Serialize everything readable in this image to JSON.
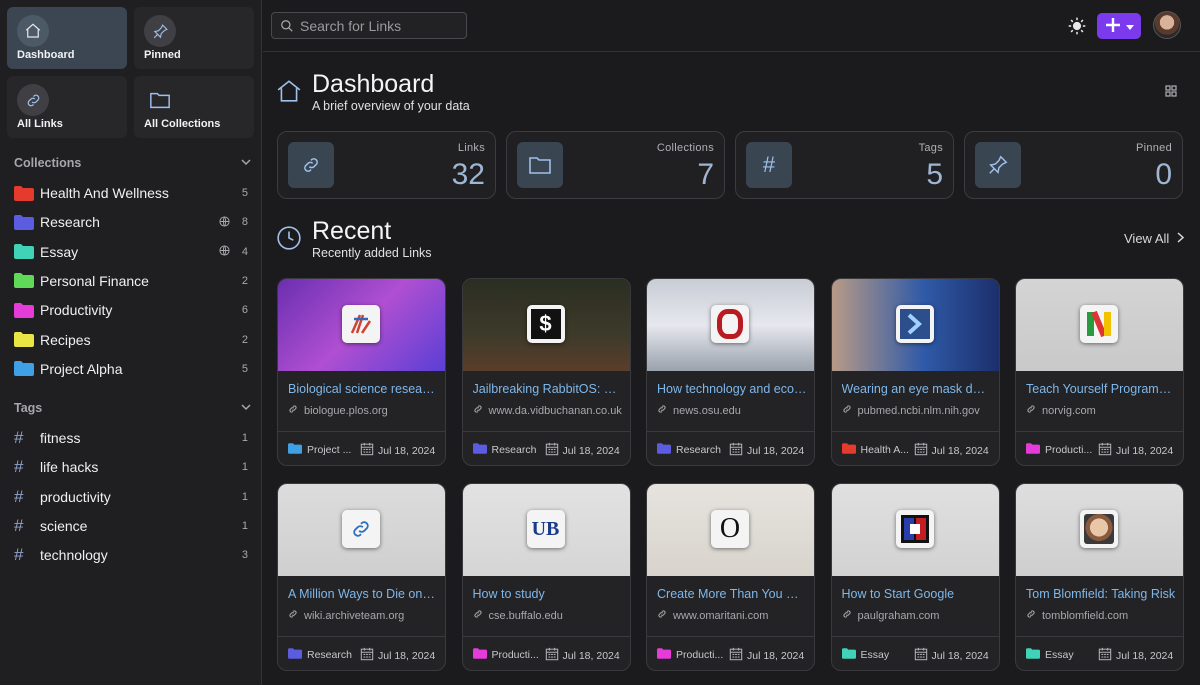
{
  "sidebar": {
    "quick": [
      {
        "label": "Dashboard"
      },
      {
        "label": "Pinned"
      },
      {
        "label": "All Links"
      },
      {
        "label": "All Collections"
      }
    ],
    "collections_heading": "Collections",
    "collections": [
      {
        "name": "Health And Wellness",
        "count": "5",
        "color": "#e53b2f",
        "public": false
      },
      {
        "name": "Research",
        "count": "8",
        "color": "#5b5ce0",
        "public": true
      },
      {
        "name": "Essay",
        "count": "4",
        "color": "#41d3b7",
        "public": true
      },
      {
        "name": "Personal Finance",
        "count": "2",
        "color": "#5fd957",
        "public": false
      },
      {
        "name": "Productivity",
        "count": "6",
        "color": "#e53bd8",
        "public": false
      },
      {
        "name": "Recipes",
        "count": "2",
        "color": "#e8e545",
        "public": false
      },
      {
        "name": "Project Alpha",
        "count": "5",
        "color": "#3fa0e6",
        "public": false
      }
    ],
    "tags_heading": "Tags",
    "tags": [
      {
        "name": "fitness",
        "count": "1"
      },
      {
        "name": "life hacks",
        "count": "1"
      },
      {
        "name": "productivity",
        "count": "1"
      },
      {
        "name": "science",
        "count": "1"
      },
      {
        "name": "technology",
        "count": "3"
      }
    ]
  },
  "topbar": {
    "search_placeholder": "Search for Links",
    "accent": "#7c3aed"
  },
  "dashboard": {
    "title": "Dashboard",
    "subtitle": "A brief overview of your data",
    "stats": [
      {
        "label": "Links",
        "value": "32",
        "icon": "link-icon"
      },
      {
        "label": "Collections",
        "value": "7",
        "icon": "folder-icon"
      },
      {
        "label": "Tags",
        "value": "5",
        "icon": "hash-icon"
      },
      {
        "label": "Pinned",
        "value": "0",
        "icon": "pin-icon"
      }
    ]
  },
  "recent": {
    "title": "Recent",
    "subtitle": "Recently added Links",
    "view_all": "View All",
    "links": [
      {
        "title": "Biological science research...",
        "domain": "biologue.plos.org",
        "collection": "Project ...",
        "coll_color": "#3fa0e6",
        "date": "Jul 18, 2024"
      },
      {
        "title": "Jailbreaking RabbitOS: Un...",
        "domain": "www.da.vidbuchanan.co.uk",
        "collection": "Research",
        "coll_color": "#5b5ce0",
        "date": "Jul 18, 2024"
      },
      {
        "title": "How technology and econ...",
        "domain": "news.osu.edu",
        "collection": "Research",
        "coll_color": "#5b5ce0",
        "date": "Jul 18, 2024"
      },
      {
        "title": "Wearing an eye mask duri...",
        "domain": "pubmed.ncbi.nlm.nih.gov",
        "collection": "Health A...",
        "coll_color": "#e53b2f",
        "date": "Jul 18, 2024"
      },
      {
        "title": "Teach Yourself Programmi...",
        "domain": "norvig.com",
        "collection": "Producti...",
        "coll_color": "#e53bd8",
        "date": "Jul 18, 2024"
      },
      {
        "title": "A Million Ways to Die on t...",
        "domain": "wiki.archiveteam.org",
        "collection": "Research",
        "coll_color": "#5b5ce0",
        "date": "Jul 18, 2024"
      },
      {
        "title": "How to study",
        "domain": "cse.buffalo.edu",
        "collection": "Producti...",
        "coll_color": "#e53bd8",
        "date": "Jul 18, 2024"
      },
      {
        "title": "Create More Than You Co...",
        "domain": "www.omaritani.com",
        "collection": "Producti...",
        "coll_color": "#e53bd8",
        "date": "Jul 18, 2024"
      },
      {
        "title": "How to Start Google",
        "domain": "paulgraham.com",
        "collection": "Essay",
        "coll_color": "#41d3b7",
        "date": "Jul 18, 2024"
      },
      {
        "title": "Tom Blomfield: Taking Risk",
        "domain": "tomblomfield.com",
        "collection": "Essay",
        "coll_color": "#41d3b7",
        "date": "Jul 18, 2024"
      }
    ]
  }
}
